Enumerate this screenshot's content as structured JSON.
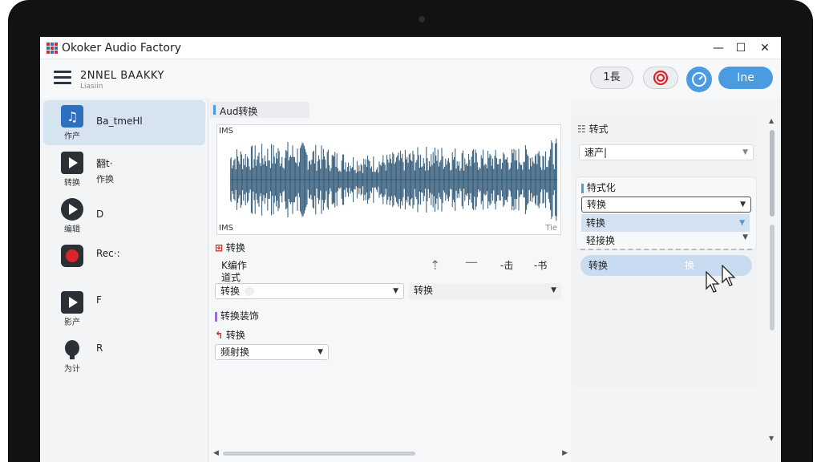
{
  "app": {
    "title": "Okoker Audio Factory"
  },
  "window": {
    "minimize": "—",
    "maximize": "☐",
    "close": "✕"
  },
  "toolbar": {
    "project_title": "2NNEL BAAKKY",
    "project_sub": "Liasiin",
    "button1_label": "1長",
    "primary_label": "Ine"
  },
  "sidebar": {
    "items": [
      {
        "label": "Ba_tmeHl",
        "sub": "作产",
        "label2": ""
      },
      {
        "label": "翻t·",
        "sub": "转换",
        "label2": "作换"
      },
      {
        "label": "D",
        "sub": "编辑",
        "label2": ""
      },
      {
        "label": "Rec·:",
        "sub": "",
        "label2": ""
      },
      {
        "label": "F",
        "sub": "影产",
        "label2": ""
      },
      {
        "label": "R",
        "sub": "为计",
        "label2": ""
      }
    ]
  },
  "main": {
    "tab_label": "Aud转换",
    "wave": {
      "tl": "IMS",
      "bl": "IMS",
      "br": "Tie"
    },
    "section1": "转换",
    "format_label1": "K编作",
    "format_label2": "道式",
    "tool_labels": [
      "-击",
      "-书"
    ],
    "dropdown1": "转换",
    "dropdown2": "转换",
    "section2": "转换装饰",
    "section3": "转换",
    "dropdown3": "频射换"
  },
  "right": {
    "heading": "转式",
    "select1": "速产|",
    "card_title": "特式化",
    "options": [
      "转换",
      "转换",
      "轻接换"
    ],
    "convert_label": "转换",
    "convert_right": "换"
  },
  "colors": {
    "accent": "#4a9be0",
    "waveform": "#2f5876",
    "record": "#d9262c"
  }
}
